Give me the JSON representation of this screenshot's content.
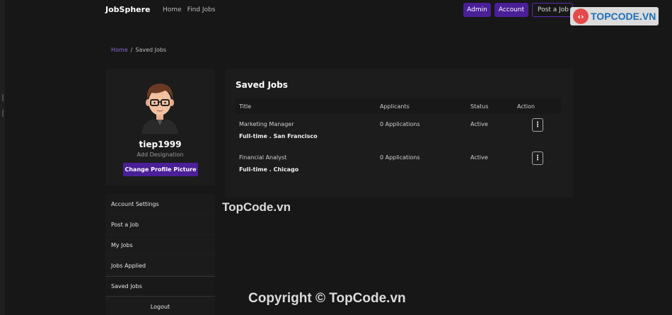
{
  "navbar": {
    "brand": "JobSphere",
    "links": [
      "Home",
      "Find Jobs"
    ],
    "admin_label": "Admin",
    "account_label": "Account",
    "post_label": "Post a Job"
  },
  "watermark": {
    "logo_text": "TOPCODE.VN",
    "middle_text": "TopCode.vn",
    "copyright_text": "Copyright © TopCode.vn"
  },
  "breadcrumb": {
    "home": "Home",
    "separator": "/",
    "current": "Saved Jobs"
  },
  "profile": {
    "username": "tiep1999",
    "designation": "Add Designation",
    "change_picture_label": "Change Profile Picture"
  },
  "side_menu": {
    "items": [
      "Account Settings",
      "Post a Job",
      "My Jobs",
      "Jobs Applied",
      "Saved Jobs",
      "Logout"
    ]
  },
  "saved_jobs": {
    "title": "Saved Jobs",
    "columns": [
      "Title",
      "Applicants",
      "Status",
      "Action"
    ],
    "rows": [
      {
        "title": "Marketing Manager",
        "meta": "Full-time . San Francisco",
        "applicants": "0 Applications",
        "status": "Active"
      },
      {
        "title": "Financial Analyst",
        "meta": "Full-time . Chicago",
        "applicants": "0 Applications",
        "status": "Active"
      }
    ]
  },
  "colors": {
    "accent": "#4a1f97",
    "link": "#8d6bd6",
    "background": "#171717",
    "card": "#1c1c1c"
  }
}
